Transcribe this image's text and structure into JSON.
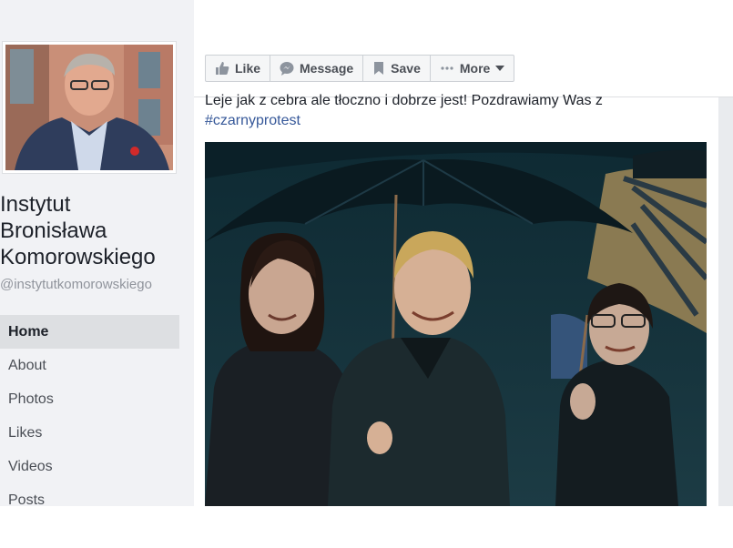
{
  "page": {
    "name_lines": [
      "Instytut",
      "Bronisława",
      "Komorowskiego"
    ],
    "handle": "@instytutkomorowskiego"
  },
  "nav": {
    "items": [
      {
        "label": "Home",
        "active": true
      },
      {
        "label": "About"
      },
      {
        "label": "Photos"
      },
      {
        "label": "Likes"
      },
      {
        "label": "Videos"
      },
      {
        "label": "Posts"
      }
    ]
  },
  "actions": {
    "like": "Like",
    "message": "Message",
    "save": "Save",
    "more": "More"
  },
  "post": {
    "text": "Leje jak z cebra ale tłoczno i dobrze jest! Pozdrawiamy Was z",
    "hashtag": "#czarnyprotest"
  },
  "colors": {
    "link": "#365899",
    "background": "#e9ebee",
    "active_nav": "#dddfe2"
  }
}
